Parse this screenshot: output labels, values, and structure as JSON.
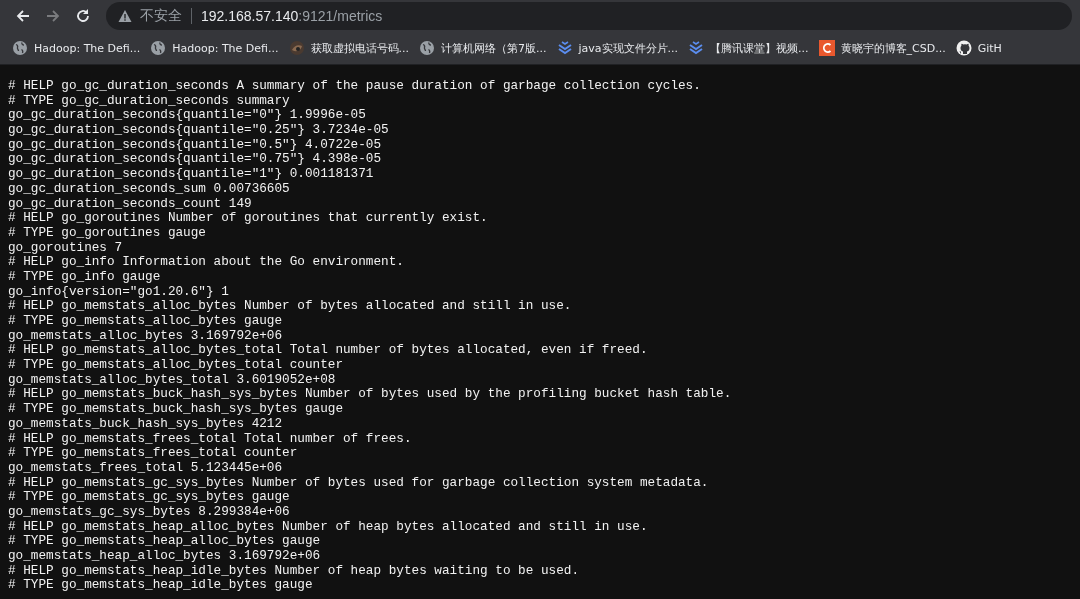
{
  "toolbar": {
    "nav_buttons": [
      {
        "kind": "back",
        "disabled": false
      },
      {
        "kind": "forward",
        "disabled": true
      },
      {
        "kind": "reload",
        "disabled": false
      }
    ],
    "security_label": "不安全",
    "url_host": "192.168.57.140",
    "url_rest": ":9121/metrics"
  },
  "bookmarks": [
    {
      "kind": "globe",
      "label": "Hadoop: The Defi..."
    },
    {
      "kind": "globe",
      "label": "Hadoop: The Defi..."
    },
    {
      "kind": "avatar",
      "label": "获取虚拟电话号码..."
    },
    {
      "kind": "globe",
      "label": "计算机网络（第7版..."
    },
    {
      "kind": "stack",
      "label": "java实现文件分片..."
    },
    {
      "kind": "stack",
      "label": "【腾讯课堂】视频..."
    },
    {
      "kind": "logo",
      "label": "黄晓宇的博客_CSD..."
    },
    {
      "kind": "octocat",
      "label": "GitH"
    }
  ],
  "lines": [
    "# HELP go_gc_duration_seconds A summary of the pause duration of garbage collection cycles.",
    "# TYPE go_gc_duration_seconds summary",
    "go_gc_duration_seconds{quantile=\"0\"} 1.9996e-05",
    "go_gc_duration_seconds{quantile=\"0.25\"} 3.7234e-05",
    "go_gc_duration_seconds{quantile=\"0.5\"} 4.0722e-05",
    "go_gc_duration_seconds{quantile=\"0.75\"} 4.398e-05",
    "go_gc_duration_seconds{quantile=\"1\"} 0.001181371",
    "go_gc_duration_seconds_sum 0.00736605",
    "go_gc_duration_seconds_count 149",
    "# HELP go_goroutines Number of goroutines that currently exist.",
    "# TYPE go_goroutines gauge",
    "go_goroutines 7",
    "# HELP go_info Information about the Go environment.",
    "# TYPE go_info gauge",
    "go_info{version=\"go1.20.6\"} 1",
    "# HELP go_memstats_alloc_bytes Number of bytes allocated and still in use.",
    "# TYPE go_memstats_alloc_bytes gauge",
    "go_memstats_alloc_bytes 3.169792e+06",
    "# HELP go_memstats_alloc_bytes_total Total number of bytes allocated, even if freed.",
    "# TYPE go_memstats_alloc_bytes_total counter",
    "go_memstats_alloc_bytes_total 3.6019052e+08",
    "# HELP go_memstats_buck_hash_sys_bytes Number of bytes used by the profiling bucket hash table.",
    "# TYPE go_memstats_buck_hash_sys_bytes gauge",
    "go_memstats_buck_hash_sys_bytes 4212",
    "# HELP go_memstats_frees_total Total number of frees.",
    "# TYPE go_memstats_frees_total counter",
    "go_memstats_frees_total 5.123445e+06",
    "# HELP go_memstats_gc_sys_bytes Number of bytes used for garbage collection system metadata.",
    "# TYPE go_memstats_gc_sys_bytes gauge",
    "go_memstats_gc_sys_bytes 8.299384e+06",
    "# HELP go_memstats_heap_alloc_bytes Number of heap bytes allocated and still in use.",
    "# TYPE go_memstats_heap_alloc_bytes gauge",
    "go_memstats_heap_alloc_bytes 3.169792e+06",
    "# HELP go_memstats_heap_idle_bytes Number of heap bytes waiting to be used.",
    "# TYPE go_memstats_heap_idle_bytes gauge"
  ]
}
